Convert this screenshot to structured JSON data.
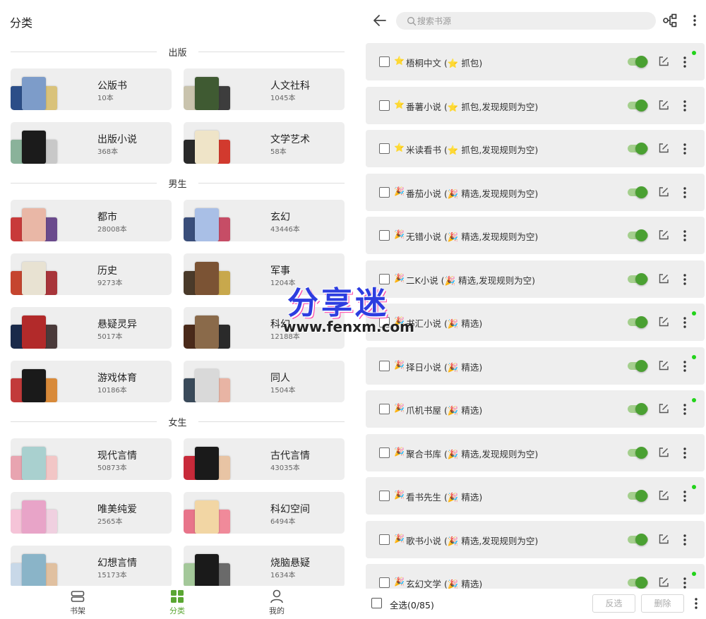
{
  "left": {
    "title": "分类",
    "sections": [
      {
        "title": "出版",
        "items": [
          {
            "name": "公版书",
            "count": "10本",
            "colors": [
              "#2c4e88",
              "#7d9cc9",
              "#d9c27a"
            ]
          },
          {
            "name": "人文社科",
            "count": "1045本",
            "colors": [
              "#c9c3ad",
              "#3f5a32",
              "#3d3d3d"
            ]
          },
          {
            "name": "出版小说",
            "count": "368本",
            "colors": [
              "#8ab29a",
              "#1b1b1b",
              "#c8c8c8"
            ]
          },
          {
            "name": "文学艺术",
            "count": "58本",
            "colors": [
              "#2a2a2a",
              "#efe4c8",
              "#d23a2e"
            ]
          }
        ]
      },
      {
        "title": "男生",
        "items": [
          {
            "name": "都市",
            "count": "28008本",
            "colors": [
              "#c83a3a",
              "#e9b7a6",
              "#6a4a8c"
            ]
          },
          {
            "name": "玄幻",
            "count": "43446本",
            "colors": [
              "#3a4e7a",
              "#a9bfe6",
              "#c64d66"
            ]
          },
          {
            "name": "历史",
            "count": "9273本",
            "colors": [
              "#c5452f",
              "#e8e2d2",
              "#a8353a"
            ]
          },
          {
            "name": "军事",
            "count": "1204本",
            "colors": [
              "#4a3a2a",
              "#7b5334",
              "#c8a84c"
            ]
          },
          {
            "name": "悬疑灵异",
            "count": "5017本",
            "colors": [
              "#1a2a4a",
              "#b22a2a",
              "#4a3a3a"
            ]
          },
          {
            "name": "科幻",
            "count": "12188本",
            "colors": [
              "#4a2a1a",
              "#8a6a4a",
              "#2a2a2a"
            ]
          },
          {
            "name": "游戏体育",
            "count": "10186本",
            "colors": [
              "#c23a3a",
              "#1a1a1a",
              "#d88a3a"
            ]
          },
          {
            "name": "同人",
            "count": "1504本",
            "colors": [
              "#3a4a5a",
              "#d9d9d9",
              "#e8b4a4"
            ]
          }
        ]
      },
      {
        "title": "女生",
        "items": [
          {
            "name": "现代言情",
            "count": "50873本",
            "colors": [
              "#e8a4b0",
              "#a9d0cf",
              "#f2c6c6"
            ]
          },
          {
            "name": "古代言情",
            "count": "43035本",
            "colors": [
              "#c82a3a",
              "#1a1a1a",
              "#e8c4a4"
            ]
          },
          {
            "name": "唯美纯爱",
            "count": "2565本",
            "colors": [
              "#f5c4d8",
              "#e8a4c8",
              "#f0d0e0"
            ]
          },
          {
            "name": "科幻空间",
            "count": "6494本",
            "colors": [
              "#e8748a",
              "#f2d6a4",
              "#f08a9a"
            ]
          },
          {
            "name": "幻想言情",
            "count": "15173本",
            "colors": [
              "#c8d8e8",
              "#8ab4c8",
              "#e0c0a0"
            ]
          },
          {
            "name": "烧脑悬疑",
            "count": "1634本",
            "colors": [
              "#a4c89a",
              "#1a1a1a",
              "#6a6a6a"
            ]
          }
        ]
      }
    ],
    "nav": [
      {
        "label": "书架",
        "icon": "bookshelf-icon"
      },
      {
        "label": "分类",
        "icon": "category-grid-icon",
        "active": true
      },
      {
        "label": "我的",
        "icon": "person-icon"
      }
    ]
  },
  "right": {
    "search": {
      "placeholder": "搜索书源"
    },
    "sources": [
      {
        "name": "梧桐中文",
        "icon": "⭐",
        "tag": "⭐",
        "desc": " 抓包)",
        "enabled": true,
        "dot": true
      },
      {
        "name": "番薯小说",
        "icon": "⭐",
        "tag": "⭐",
        "desc": " 抓包,发现规则为空)",
        "enabled": true,
        "dot": false
      },
      {
        "name": "米读看书",
        "icon": "⭐",
        "tag": "⭐",
        "desc": " 抓包,发现规则为空)",
        "enabled": true,
        "dot": false
      },
      {
        "name": "番茄小说",
        "icon": "🎉",
        "tag": "🎉",
        "desc": " 精选,发现规则为空)",
        "enabled": true,
        "dot": false
      },
      {
        "name": "无错小说",
        "icon": "🎉",
        "tag": "🎉",
        "desc": " 精选,发现规则为空)",
        "enabled": true,
        "dot": false
      },
      {
        "name": "二K小说",
        "icon": "🎉",
        "tag": "🎉",
        "desc": " 精选,发现规则为空)",
        "enabled": true,
        "dot": false
      },
      {
        "name": "书汇小说",
        "icon": "🎉",
        "tag": "🎉",
        "desc": " 精选)",
        "enabled": true,
        "dot": true
      },
      {
        "name": "择日小说",
        "icon": "🎉",
        "tag": "🎉",
        "desc": " 精选)",
        "enabled": true,
        "dot": true
      },
      {
        "name": "爪机书屋",
        "icon": "🎉",
        "tag": "🎉",
        "desc": " 精选)",
        "enabled": true,
        "dot": true
      },
      {
        "name": "聚合书库",
        "icon": "🎉",
        "tag": "🎉",
        "desc": " 精选,发现规则为空)",
        "enabled": true,
        "dot": false
      },
      {
        "name": "看书先生",
        "icon": "🎉",
        "tag": "🎉",
        "desc": " 精选)",
        "enabled": true,
        "dot": true
      },
      {
        "name": "歌书小说",
        "icon": "🎉",
        "tag": "🎉",
        "desc": " 精选,发现规则为空)",
        "enabled": true,
        "dot": false
      },
      {
        "name": "玄幻文学",
        "icon": "🎉",
        "tag": "🎉",
        "desc": " 精选)",
        "enabled": true,
        "dot": true
      }
    ],
    "bottom": {
      "select_all": "全选(0/85)",
      "invert": "反选",
      "delete": "删除"
    }
  },
  "watermark": {
    "big": "分享迷",
    "small": "www.fenxm.com"
  }
}
